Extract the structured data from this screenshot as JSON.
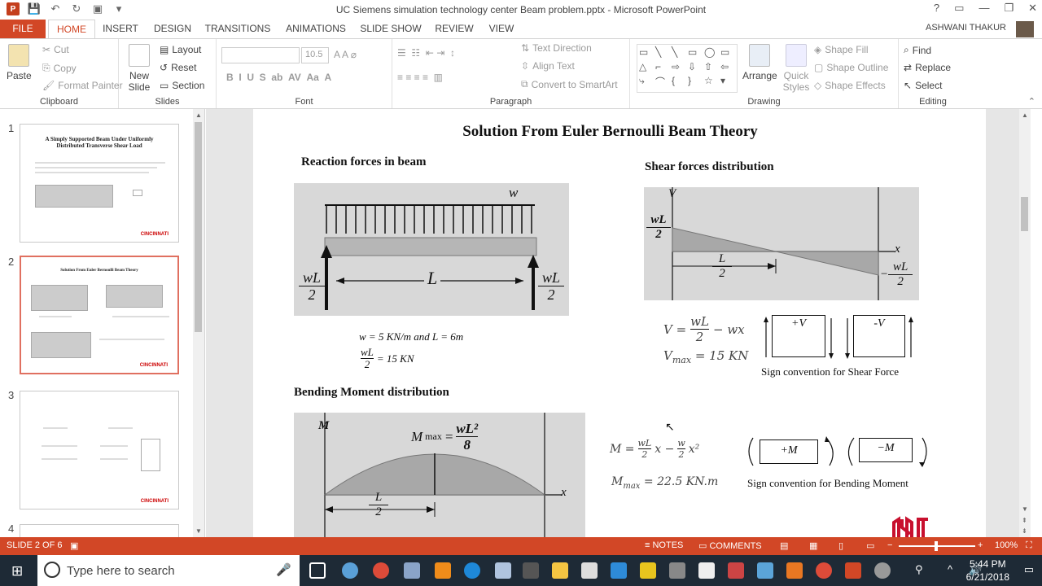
{
  "window": {
    "title": "UC Siemens simulation technology center Beam problem.pptx - Microsoft PowerPoint",
    "user": "ASHWANI THAKUR",
    "help": "?",
    "controls": [
      "▭",
      "—",
      "❐",
      "✕"
    ]
  },
  "tabs": [
    "FILE",
    "HOME",
    "INSERT",
    "DESIGN",
    "TRANSITIONS",
    "ANIMATIONS",
    "SLIDE SHOW",
    "REVIEW",
    "VIEW"
  ],
  "active_tab": "HOME",
  "ribbon": {
    "clipboard": {
      "label": "Clipboard",
      "paste": "Paste",
      "cut": "Cut",
      "copy": "Copy",
      "format_painter": "Format Painter"
    },
    "slides": {
      "label": "Slides",
      "new_slide": "New Slide",
      "layout": "Layout",
      "reset": "Reset",
      "section": "Section"
    },
    "font": {
      "label": "Font",
      "size": "10.5"
    },
    "paragraph": {
      "label": "Paragraph",
      "text_direction": "Text Direction",
      "align_text": "Align Text",
      "convert": "Convert to SmartArt"
    },
    "drawing": {
      "label": "Drawing",
      "arrange": "Arrange",
      "quick_styles": "Quick Styles",
      "shape_fill": "Shape Fill",
      "shape_outline": "Shape Outline",
      "shape_effects": "Shape Effects"
    },
    "editing": {
      "label": "Editing",
      "find": "Find",
      "replace": "Replace",
      "select": "Select"
    }
  },
  "thumbnails": [
    {
      "num": "1",
      "title": "A Simply Supported Beam Under Uniformly Distributed Transverse Shear Load",
      "logo": "CINCINNATI"
    },
    {
      "num": "2",
      "title": "Solution From Euler Bernoulli Beam Theory",
      "logo": "CINCINNATI"
    },
    {
      "num": "3",
      "title": "",
      "logo": "CINCINNATI"
    },
    {
      "num": "4",
      "title": "",
      "logo": ""
    }
  ],
  "slide": {
    "title": "Solution From Euler Bernoulli Beam Theory",
    "reaction_heading": "Reaction forces in beam",
    "shear_heading": "Shear forces distribution",
    "bending_heading": "Bending Moment distribution",
    "reaction_eq1": "w = 5 KN/m and L = 6m",
    "reaction_eq2_num": "wL",
    "reaction_eq2_den": "2",
    "reaction_eq2_rest": "= 15 KN",
    "shear_eq1_lhs": "V =",
    "shear_eq1_num": "wL",
    "shear_eq1_den": "2",
    "shear_eq1_rest": "− wx",
    "shear_eq2": "= 15 KN",
    "shear_eq2_v": "V",
    "shear_eq2_sub": "max",
    "shear_plus": "+V",
    "shear_minus": "-V",
    "shear_caption": "Sign convention for Shear Force",
    "moment_eq1_lhs": "M =",
    "moment_eq1_num1": "wL",
    "moment_eq1_den1": "2",
    "moment_eq1_mid": "x −",
    "moment_eq1_num2": "w",
    "moment_eq1_den2": "2",
    "moment_eq1_rest": "x²",
    "moment_eq2": "= 22.5 KN.m",
    "moment_eq2_m": "M",
    "moment_eq2_sub": "max",
    "moment_plus": "+M",
    "moment_minus": "−M",
    "moment_caption": "Sign convention for Bending Moment",
    "fig_w": "w",
    "fig_L": "L",
    "fig_wL": "wL",
    "fig_2": "2",
    "fig_V": "V",
    "fig_x": "x",
    "fig_M": "M",
    "fig_Mmax": "M",
    "fig_Mmax_sub": "max",
    "fig_Mmax_eq": "= ",
    "fig_Mmax_num": "wL²",
    "fig_Mmax_den": "8",
    "fig_minus": "−"
  },
  "status": {
    "slide_info": "SLIDE 2 OF 6",
    "notes": "NOTES",
    "comments": "COMMENTS",
    "zoom": "100%"
  },
  "taskbar": {
    "search_placeholder": "Type here to search",
    "time": "5:44 PM",
    "date": "6/21/2018"
  }
}
